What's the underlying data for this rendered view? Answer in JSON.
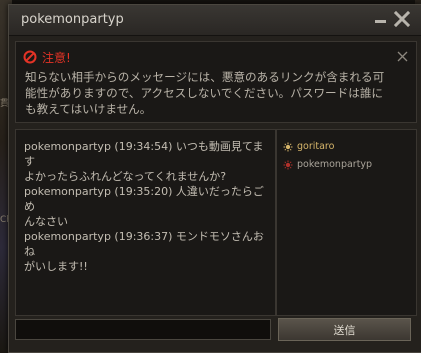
{
  "window": {
    "title": "pokemonpartyp"
  },
  "warning": {
    "title": "注意!",
    "lines": [
      "知らない相手からのメッセージには、悪意のあるリンクが含まれる可",
      "能性がありますので、アクセスしないでください。パスワードは誰に",
      "も教えてはいけません。"
    ]
  },
  "messages": [
    {
      "lines": [
        "pokemonpartyp (19:34:54) いつも動画見てます",
        "よかったらふれんどなってくれませんか?"
      ]
    },
    {
      "lines": [
        "pokemonpartyp (19:35:20) 人違いだったらごめ",
        "んなさい"
      ]
    },
    {
      "lines": [
        "pokemonpartyp (19:36:37) モンドモソさんおね",
        "がいします!!"
      ]
    }
  ],
  "participants": [
    {
      "name": "goritaro",
      "color": "#d6b56a"
    },
    {
      "name": "pokemonpartyp",
      "color": "#b0302a"
    }
  ],
  "input": {
    "value": ""
  },
  "send_button": {
    "label": "送信"
  },
  "colors": {
    "warning_red": "#e43326",
    "text": "#c3bdb2",
    "panel_bg": "#1a1816"
  }
}
